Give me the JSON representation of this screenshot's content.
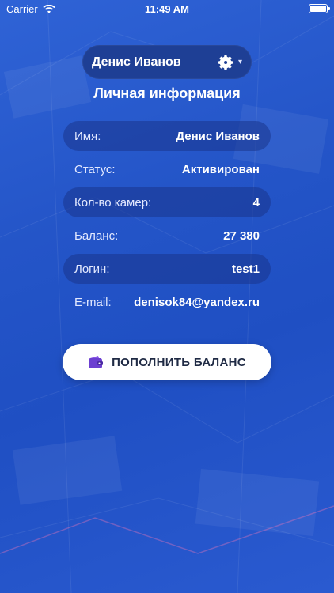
{
  "status_bar": {
    "carrier": "Carrier",
    "time": "11:49 AM"
  },
  "header": {
    "user_name": "Денис Иванов"
  },
  "title": "Личная информация",
  "info": [
    {
      "label": "Имя:",
      "value": "Денис Иванов"
    },
    {
      "label": "Статус:",
      "value": "Активирован"
    },
    {
      "label": "Кол-во камер:",
      "value": "4"
    },
    {
      "label": "Баланс:",
      "value": "27 380"
    },
    {
      "label": "Логин:",
      "value": "test1"
    },
    {
      "label": "E-mail:",
      "value": "denisok84@yandex.ru"
    }
  ],
  "topup_label": "ПОПОЛНИТЬ БАЛАНС",
  "icons": [
    "wifi-icon",
    "battery-icon",
    "gear-icon",
    "chevron-down-icon",
    "wallet-icon"
  ],
  "colors": {
    "background": "#2455c8",
    "pill": "#1e3f95",
    "button": "#ffffff",
    "wallet": "#6c3fd1"
  }
}
